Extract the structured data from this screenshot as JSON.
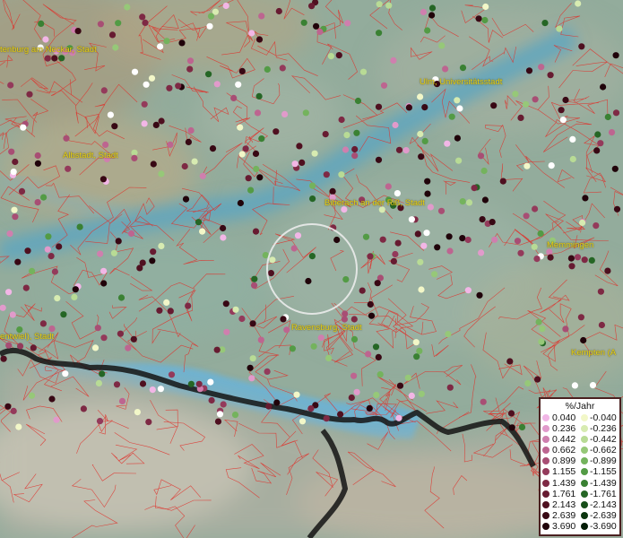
{
  "cities": [
    {
      "id": "city-nuertingen",
      "label": "tenburg am Neckar, Stadt"
    },
    {
      "id": "city-ulm",
      "label": "Ulm, Universitätsstadt"
    },
    {
      "id": "city-albstadt",
      "label": "Albstadt, Stadt"
    },
    {
      "id": "city-biberach",
      "label": "Biberach an der Riß, Stadt"
    },
    {
      "id": "city-memmingen",
      "label": "Memmingen"
    },
    {
      "id": "city-ravensburg",
      "label": "Ravensburg, Stadt"
    },
    {
      "id": "city-singen",
      "label": "entwiel), Stadt"
    },
    {
      "id": "city-kempten",
      "label": "Kempten (A"
    }
  ],
  "legend": {
    "title": "%/Jahr",
    "positive": [
      {
        "value": "0.040",
        "color": "#f2b6e6"
      },
      {
        "value": "0.236",
        "color": "#e19acb"
      },
      {
        "value": "0.442",
        "color": "#cf7fae"
      },
      {
        "value": "0.662",
        "color": "#bd6590"
      },
      {
        "value": "0.899",
        "color": "#a84e74"
      },
      {
        "value": "1.155",
        "color": "#943a5b"
      },
      {
        "value": "1.439",
        "color": "#7e2944"
      },
      {
        "value": "1.761",
        "color": "#671b31"
      },
      {
        "value": "2.143",
        "color": "#4f1020"
      },
      {
        "value": "2.639",
        "color": "#380814"
      },
      {
        "value": "3.690",
        "color": "#20030a"
      }
    ],
    "negative": [
      {
        "value": "-0.040",
        "color": "#f2f7c8"
      },
      {
        "value": "-0.236",
        "color": "#d7ebb1"
      },
      {
        "value": "-0.442",
        "color": "#b8db95"
      },
      {
        "value": "-0.662",
        "color": "#96c878"
      },
      {
        "value": "-0.899",
        "color": "#74b35d"
      },
      {
        "value": "-1.155",
        "color": "#539b45"
      },
      {
        "value": "-1.439",
        "color": "#3a8133"
      },
      {
        "value": "-1.761",
        "color": "#256625"
      },
      {
        "value": "-2.143",
        "color": "#174e19"
      },
      {
        "value": "-2.639",
        "color": "#0c360f"
      },
      {
        "value": "-3.690",
        "color": "#041d06"
      }
    ]
  }
}
